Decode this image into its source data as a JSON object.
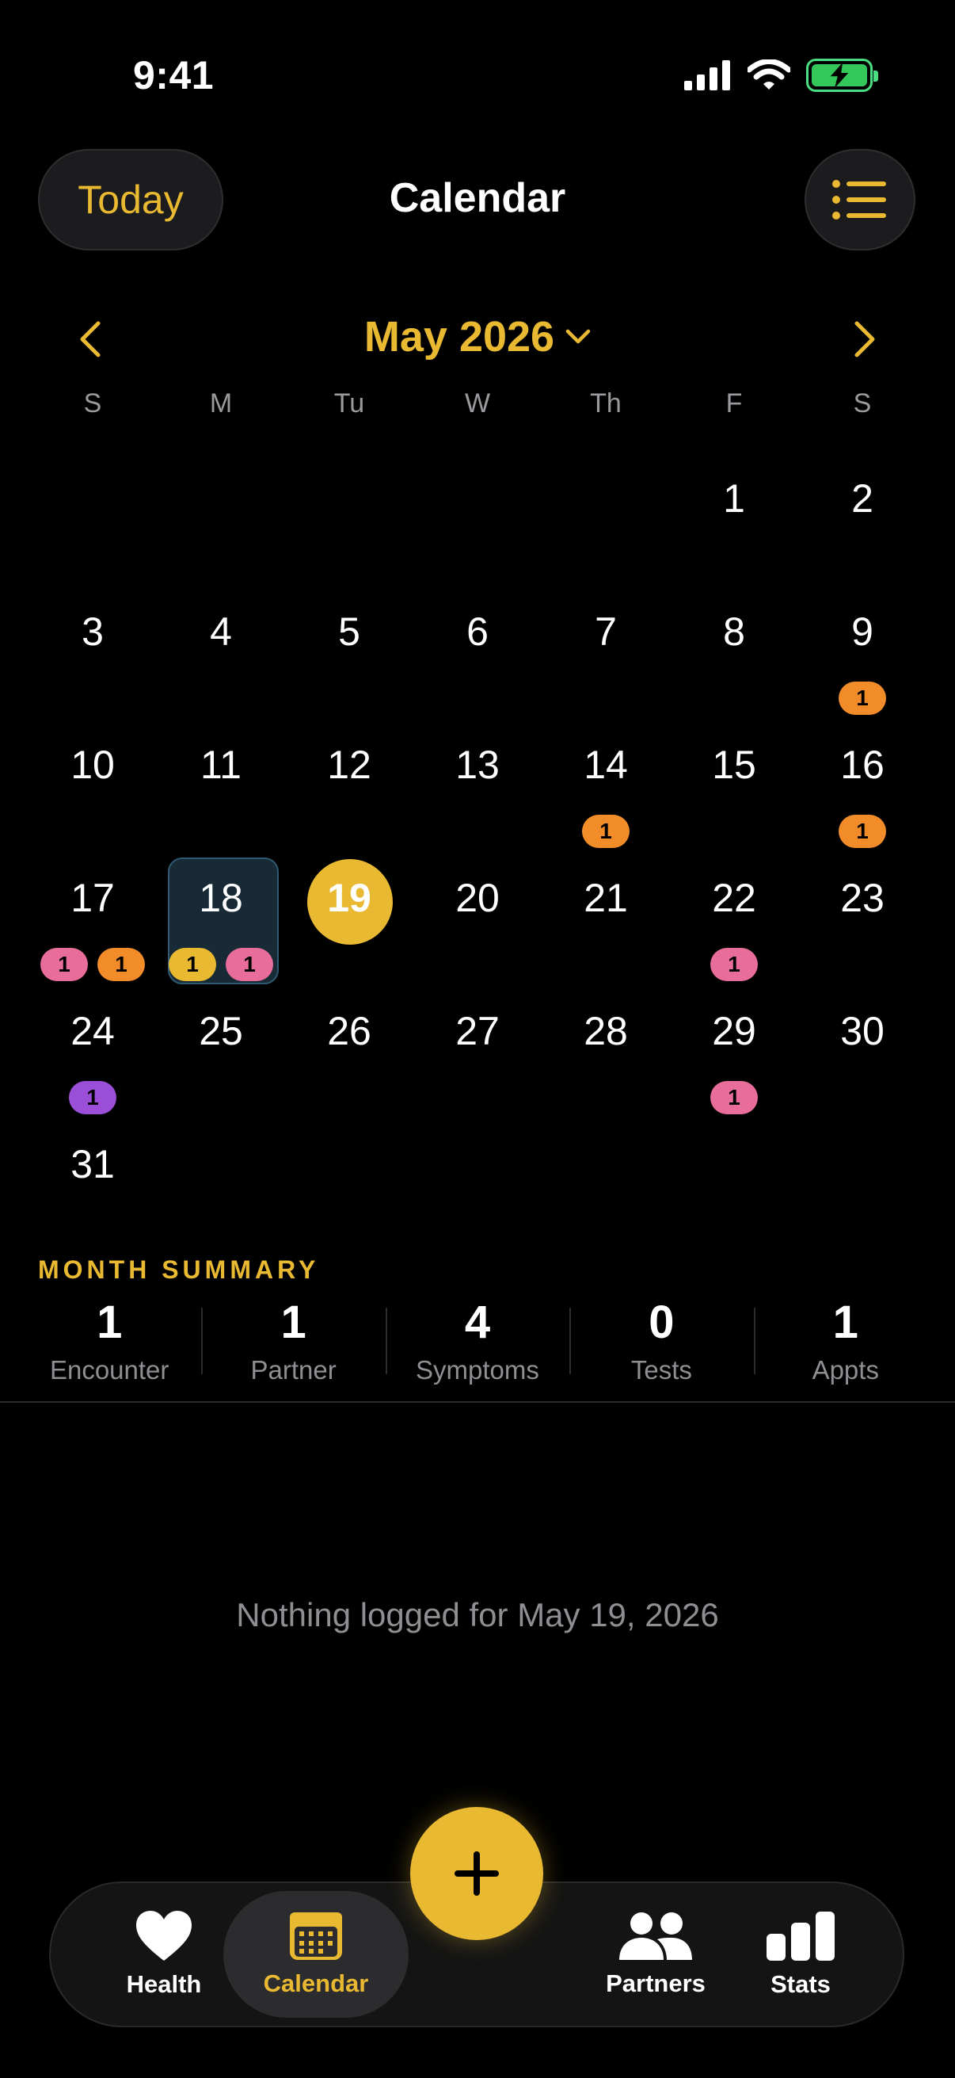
{
  "status_bar": {
    "time": "9:41"
  },
  "header": {
    "today_label": "Today",
    "title": "Calendar"
  },
  "month_nav": {
    "title": "May 2026"
  },
  "weekdays": [
    "S",
    "M",
    "Tu",
    "W",
    "Th",
    "F",
    "S"
  ],
  "calendar": {
    "weeks": [
      [
        {
          "n": ""
        },
        {
          "n": ""
        },
        {
          "n": ""
        },
        {
          "n": ""
        },
        {
          "n": ""
        },
        {
          "n": "1"
        },
        {
          "n": "2"
        }
      ],
      [
        {
          "n": "3"
        },
        {
          "n": "4"
        },
        {
          "n": "5"
        },
        {
          "n": "6"
        },
        {
          "n": "7"
        },
        {
          "n": "8"
        },
        {
          "n": "9",
          "badges": [
            {
              "count": "1",
              "color": "#f28c28"
            }
          ]
        }
      ],
      [
        {
          "n": "10"
        },
        {
          "n": "11"
        },
        {
          "n": "12"
        },
        {
          "n": "13"
        },
        {
          "n": "14",
          "badges": [
            {
              "count": "1",
              "color": "#f28c28"
            }
          ]
        },
        {
          "n": "15"
        },
        {
          "n": "16",
          "badges": [
            {
              "count": "1",
              "color": "#f28c28"
            }
          ]
        }
      ],
      [
        {
          "n": "17",
          "badges": [
            {
              "count": "1",
              "color": "#e86d9a"
            },
            {
              "count": "1",
              "color": "#f28c28"
            }
          ]
        },
        {
          "n": "18",
          "selected": true,
          "badges": [
            {
              "count": "1",
              "color": "#e8b931"
            },
            {
              "count": "1",
              "color": "#e86d9a"
            }
          ]
        },
        {
          "n": "19",
          "today": true
        },
        {
          "n": "20"
        },
        {
          "n": "21"
        },
        {
          "n": "22",
          "badges": [
            {
              "count": "1",
              "color": "#e86d9a"
            }
          ]
        },
        {
          "n": "23"
        }
      ],
      [
        {
          "n": "24",
          "badges": [
            {
              "count": "1",
              "color": "#9b4fd8"
            }
          ]
        },
        {
          "n": "25"
        },
        {
          "n": "26"
        },
        {
          "n": "27"
        },
        {
          "n": "28"
        },
        {
          "n": "29",
          "badges": [
            {
              "count": "1",
              "color": "#e86d9a"
            }
          ]
        },
        {
          "n": "30"
        }
      ],
      [
        {
          "n": "31"
        },
        {
          "n": ""
        },
        {
          "n": ""
        },
        {
          "n": ""
        },
        {
          "n": ""
        },
        {
          "n": ""
        },
        {
          "n": ""
        }
      ]
    ]
  },
  "summary": {
    "label": "MONTH SUMMARY",
    "stats": [
      {
        "value": "1",
        "label": "Encounter"
      },
      {
        "value": "1",
        "label": "Partner"
      },
      {
        "value": "4",
        "label": "Symptoms"
      },
      {
        "value": "0",
        "label": "Tests"
      },
      {
        "value": "1",
        "label": "Appts"
      }
    ]
  },
  "empty_message": "Nothing logged for May 19, 2026",
  "tabs": [
    {
      "label": "Health",
      "icon": "heart-icon",
      "active": false
    },
    {
      "label": "Calendar",
      "icon": "calendar-icon",
      "active": true
    },
    {
      "label": "Partners",
      "icon": "people-icon",
      "active": false
    },
    {
      "label": "Stats",
      "icon": "bar-chart-icon",
      "active": false
    }
  ],
  "colors": {
    "accent": "#e8b931",
    "orange": "#f28c28",
    "pink": "#e86d9a",
    "purple": "#9b4fd8",
    "selected_bg": "#172a36"
  }
}
